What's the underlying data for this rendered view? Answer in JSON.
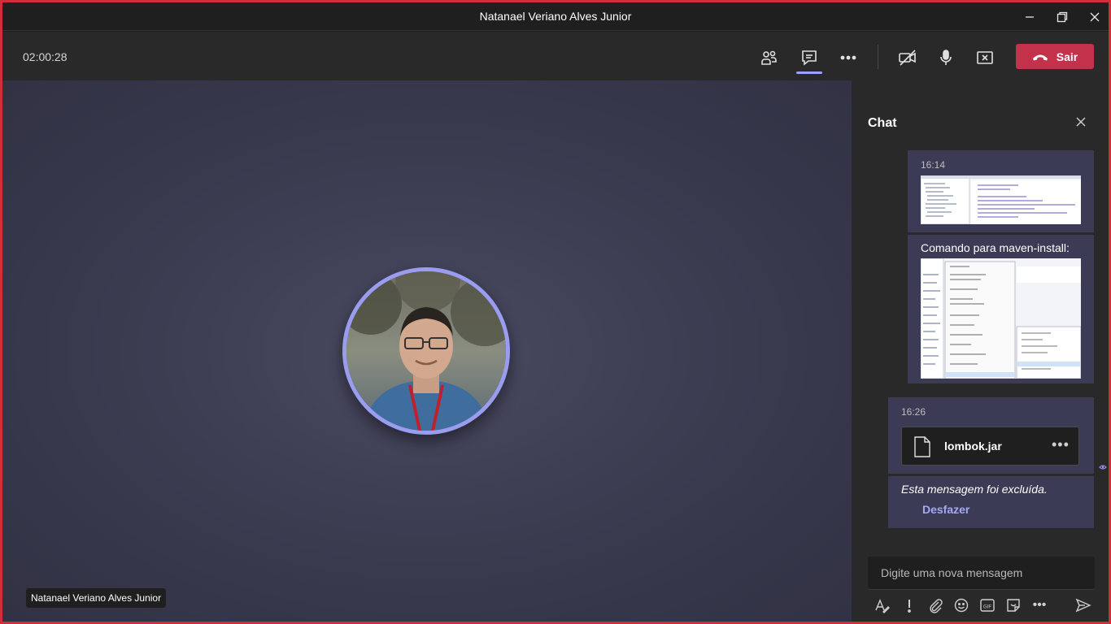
{
  "window": {
    "title": "Natanael Veriano Alves Junior",
    "controls": [
      "minimize-icon",
      "restore-icon",
      "close-icon"
    ]
  },
  "toolbar": {
    "timer": "02:00:28",
    "buttons": [
      "participants-icon",
      "chat-icon",
      "more-options-icon",
      "camera-off-icon",
      "microphone-icon",
      "stop-share-icon"
    ],
    "leave_label": "Sair",
    "leave_color": "#c4314b",
    "active_indicator_color": "#9ea2ff"
  },
  "stage": {
    "participant_name": "Natanael Veriano Alves Junior",
    "avatar_ring_color": "#9a9cf0"
  },
  "chat": {
    "title": "Chat",
    "messages": [
      {
        "time": "16:14",
        "attachment": "screenshot-image"
      },
      {
        "text": "Comando para maven-install:",
        "attachment": "screenshot-image"
      },
      {
        "time": "16:26",
        "file": {
          "name": "lombok.jar",
          "more": "•••"
        }
      },
      {
        "deleted_text": "Esta mensagem foi excluída.",
        "undo_label": "Desfazer"
      }
    ],
    "compose": {
      "placeholder": "Digite uma nova mensagem"
    },
    "compose_tools": [
      "format-icon",
      "important-icon",
      "attach-icon",
      "emoji-icon",
      "gif-icon",
      "sticker-icon",
      "more-icon",
      "send-icon"
    ],
    "more_label": "•••"
  }
}
